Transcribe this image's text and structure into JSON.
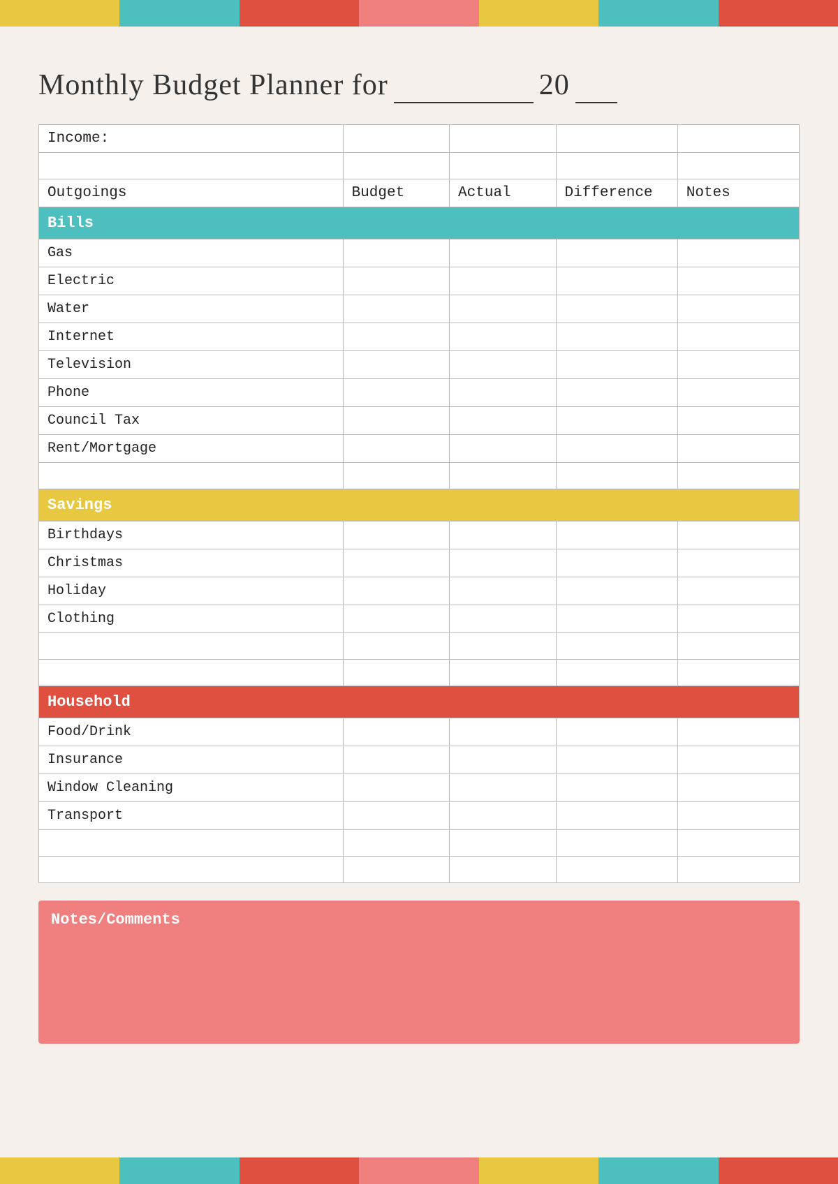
{
  "banner": {
    "blocks": [
      {
        "color": "c-yellow"
      },
      {
        "color": "c-teal"
      },
      {
        "color": "c-red"
      },
      {
        "color": "c-pink"
      },
      {
        "color": "c-yellow2"
      },
      {
        "color": "c-teal2"
      },
      {
        "color": "c-red2"
      }
    ]
  },
  "title": {
    "prefix": "Monthly Budget Planner for",
    "year_prefix": "20"
  },
  "table": {
    "income_label": "Income:",
    "outgoings_label": "Outgoings",
    "budget_col": "Budget",
    "actual_col": "Actual",
    "difference_col": "Difference",
    "notes_col": "Notes",
    "sections": {
      "bills": {
        "label": "Bills",
        "items": [
          "Gas",
          "Electric",
          "Water",
          "Internet",
          "Television",
          "Phone",
          "Council Tax",
          "Rent/Mortgage"
        ]
      },
      "savings": {
        "label": "Savings",
        "items": [
          "Birthdays",
          "Christmas",
          "Holiday",
          "Clothing"
        ]
      },
      "household": {
        "label": "Household",
        "items": [
          "Food/Drink",
          "Insurance",
          "Window Cleaning",
          "Transport"
        ]
      }
    }
  },
  "notes_section": {
    "title": "Notes/Comments"
  }
}
